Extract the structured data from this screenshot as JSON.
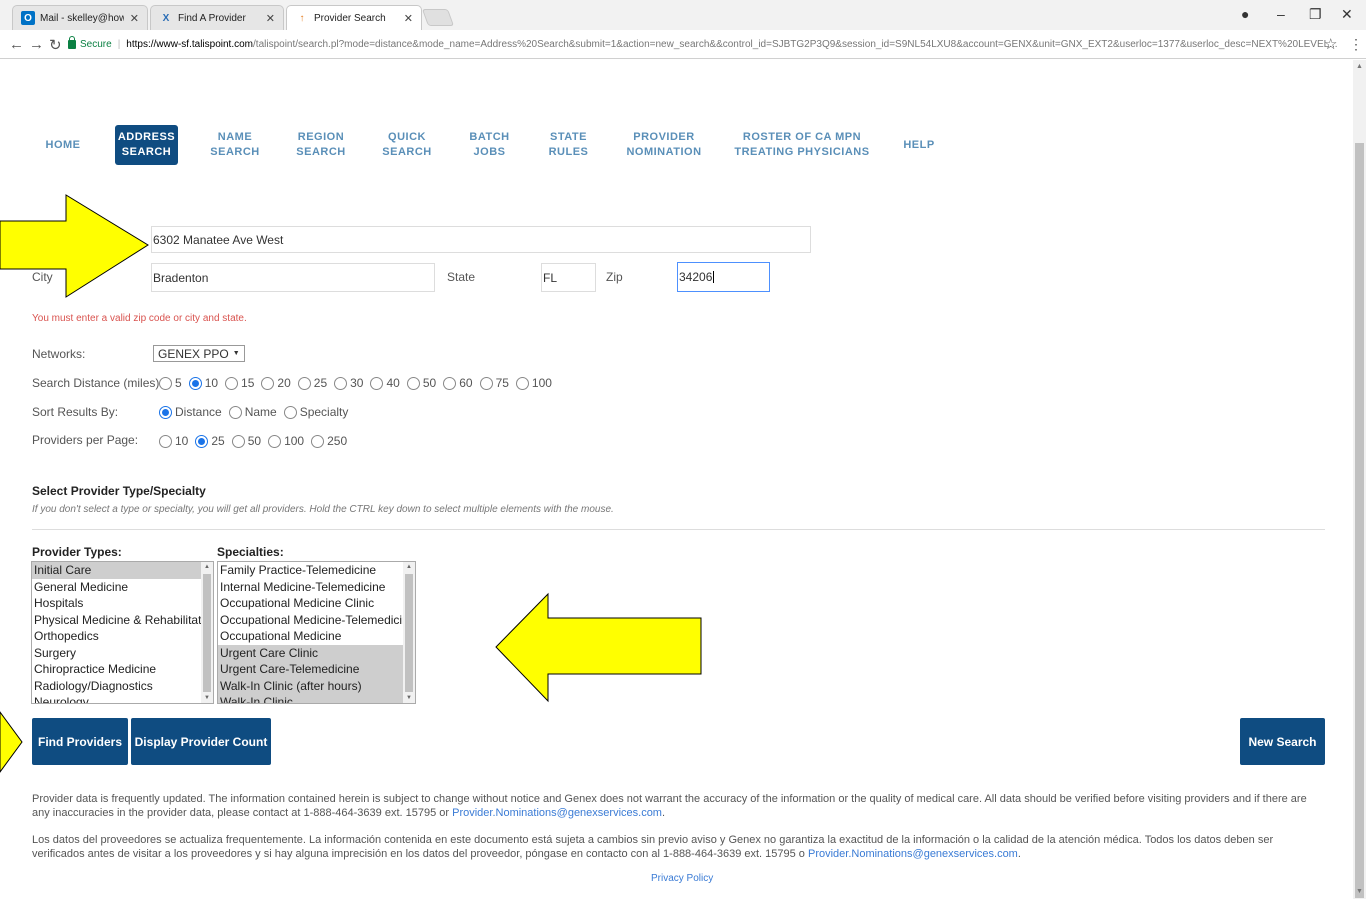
{
  "browser": {
    "tabs": [
      {
        "title": "Mail - skelley@howardle",
        "favicon": "O"
      },
      {
        "title": "Find A Provider",
        "favicon": "X"
      },
      {
        "title": "Provider Search",
        "favicon": "↑"
      }
    ],
    "secure_label": "Secure",
    "url_host": "https://www-sf.talispoint.com",
    "url_rest": "/talispoint/search.pl?mode=distance&mode_name=Address%20Search&submit=1&action=new_search&&control_id=SJBTG2P3Q9&session_id=S9NL54LXU8&account=GENX&unit=GNX_EXT2&userloc=1377&userloc_desc=NEXT%20LEVEL..."
  },
  "nav": {
    "items": [
      {
        "label": "HOME",
        "active": false
      },
      {
        "label": "ADDRESS\nSEARCH",
        "active": true
      },
      {
        "label": "NAME\nSEARCH",
        "active": false
      },
      {
        "label": "REGION\nSEARCH",
        "active": false
      },
      {
        "label": "QUICK\nSEARCH",
        "active": false
      },
      {
        "label": "BATCH\nJOBS",
        "active": false
      },
      {
        "label": "STATE\nRULES",
        "active": false
      },
      {
        "label": "PROVIDER\nNOMINATION",
        "active": false
      },
      {
        "label": "ROSTER OF CA MPN\nTREATING PHYSICIANS",
        "active": false
      },
      {
        "label": "HELP",
        "active": false
      }
    ]
  },
  "form": {
    "address_value": "6302 Manatee Ave West",
    "city_label": "City",
    "city_value": "Bradenton",
    "state_label": "State",
    "state_value": "FL",
    "zip_label": "Zip",
    "zip_value": "34206",
    "error": "You must enter a valid zip code or city and state.",
    "networks_label": "Networks:",
    "network_selected": "GENEX PPO",
    "distance_label": "Search Distance (miles):",
    "distance_options": [
      "5",
      "10",
      "15",
      "20",
      "25",
      "30",
      "40",
      "50",
      "60",
      "75",
      "100"
    ],
    "distance_selected": "10",
    "sort_label": "Sort Results By:",
    "sort_options": [
      "Distance",
      "Name",
      "Specialty"
    ],
    "sort_selected": "Distance",
    "per_page_label": "Providers per Page:",
    "per_page_options": [
      "10",
      "25",
      "50",
      "100",
      "250"
    ],
    "per_page_selected": "25"
  },
  "specialty_section": {
    "title": "Select Provider Type/Specialty",
    "hint": "If you don't select a type or specialty, you will get all providers. Hold the CTRL key down to select multiple elements with the mouse.",
    "provider_types_label": "Provider Types:",
    "provider_types": [
      {
        "label": "Initial Care",
        "selected": true
      },
      {
        "label": "General Medicine",
        "selected": false
      },
      {
        "label": "Hospitals",
        "selected": false
      },
      {
        "label": "Physical Medicine & Rehabilitation",
        "selected": false
      },
      {
        "label": "Orthopedics",
        "selected": false
      },
      {
        "label": "Surgery",
        "selected": false
      },
      {
        "label": "Chiropractice Medicine",
        "selected": false
      },
      {
        "label": "Radiology/Diagnostics",
        "selected": false
      },
      {
        "label": "Neurology",
        "selected": false
      }
    ],
    "specialties_label": "Specialties:",
    "specialties": [
      {
        "label": "Family Practice-Telemedicine",
        "selected": false
      },
      {
        "label": "Internal Medicine-Telemedicine",
        "selected": false
      },
      {
        "label": "Occupational Medicine Clinic",
        "selected": false
      },
      {
        "label": "Occupational Medicine-Telemedicine",
        "selected": false
      },
      {
        "label": "Occupational Medicine",
        "selected": false
      },
      {
        "label": "Urgent Care Clinic",
        "selected": true
      },
      {
        "label": "Urgent Care-Telemedicine",
        "selected": true
      },
      {
        "label": "Walk-In Clinic (after hours)",
        "selected": true
      },
      {
        "label": "Walk-In Clinic",
        "selected": true
      }
    ]
  },
  "buttons": {
    "find": "Find Providers",
    "count": "Display Provider Count",
    "new_search": "New Search"
  },
  "footer": {
    "en_text": "Provider data is frequently updated. The information contained herein is subject to change without notice and Genex does not warrant the accuracy of the information or the quality of medical care. All data should be verified before visiting providers and if there are any inaccuracies in the provider data, please contact at 1-888-464-3639 ext. 15795 or ",
    "en_link": "Provider.Nominations@genexservices.com",
    "en_end": ".",
    "es_text": "Los datos del proveedores se actualiza frequentemente. La información contenida en este documento está sujeta a cambios sin previo aviso y Genex no garantiza la exactitud de la información o la calidad de la atención médica. Todos los datos deben ser verificados antes de visitar a los proveedores y si hay alguna imprecisión en los datos del proveedor, póngase en contacto con al 1-888-464-3639 ext. 15795 o ",
    "es_link": "Provider.Nominations@genexservices.com",
    "es_end": ".",
    "privacy": "Privacy Policy"
  },
  "colors": {
    "primary": "#0f4c81",
    "nav_text": "#5a8fb8",
    "error": "#d9534f",
    "link": "#3a7bd5",
    "annotation_arrow": "#ffff00"
  }
}
